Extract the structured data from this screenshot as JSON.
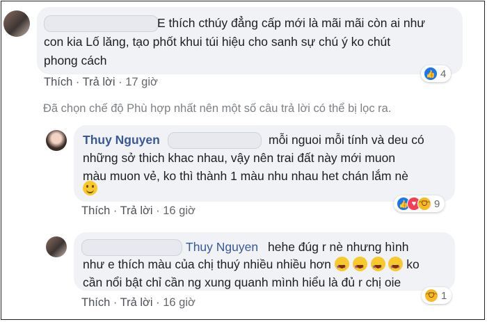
{
  "comment1": {
    "line1": "E thích cthúy đẳng cấp mới là mãi mãi còn ai như",
    "line2": "con kia Lố lăng, tạo phốt khui túi hiệu cho sanh sự chú ý ko chút",
    "line3": "phong cách",
    "reaction_count": "4",
    "actions": {
      "like": "Thích",
      "reply": "Trả lời",
      "time": "17 giờ"
    }
  },
  "filter_notice": "Đã chọn chế độ Phù hợp nhất nên một số câu trả lời có thể bị lọc ra.",
  "reply1": {
    "author": "Thuy Nguyen",
    "line1": "mỗi nguoi mỗi tính và deu có",
    "line2": "những sở thich khac nhau, vậy nên trai đất này mới muon",
    "line3": "màu muon vẻ, ko thì thành 1 màu nhu nhau het chán lắm nè",
    "reaction_count": "9",
    "actions": {
      "like": "Thích",
      "reply": "Trả lời",
      "time": "16 giờ"
    }
  },
  "reply2": {
    "mention": "Thuy Nguyen",
    "line1": "hehe đúg r nè nhưng hình",
    "line2": "như e thích màu của chị thuý nhiều nhiều hơn",
    "line2_end": "ko",
    "line3": "cần nổi bật chỉ cần ng xung quanh mình hiểu là đủ r chị oie",
    "reaction_count": "1",
    "actions": {
      "like": "Thích",
      "reply": "Trả lời",
      "time": "16 giờ"
    }
  },
  "icons": {
    "like": "like-icon",
    "love": "love-icon",
    "haha": "haha-icon",
    "smile": "smile-emoji",
    "star_struck": "star-struck-emoji"
  },
  "colors": {
    "link": "#385898",
    "bubble": "#f0f2f5",
    "like_blue": "#1877f2"
  }
}
